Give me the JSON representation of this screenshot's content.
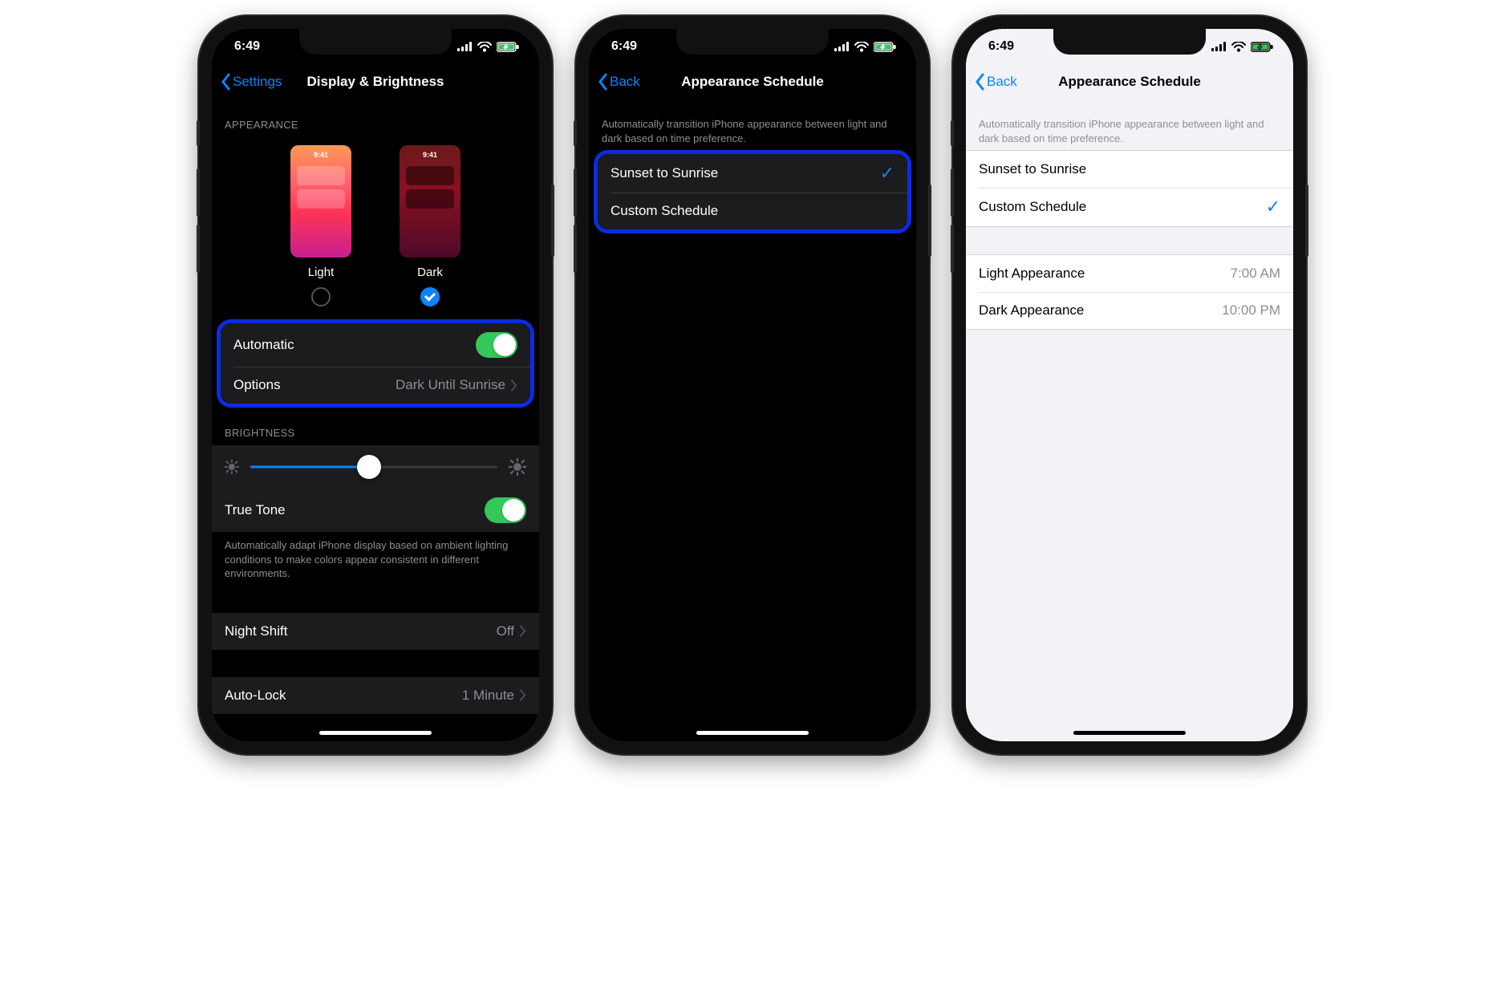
{
  "status": {
    "time": "6:49"
  },
  "screen1": {
    "back_label": "Settings",
    "title": "Display & Brightness",
    "appearance_header": "Appearance",
    "thumb_time": "9:41",
    "light_label": "Light",
    "dark_label": "Dark",
    "automatic_label": "Automatic",
    "options_label": "Options",
    "options_value": "Dark Until Sunrise",
    "brightness_header": "Brightness",
    "brightness_value_pct": 48,
    "truetone_label": "True Tone",
    "truetone_footer": "Automatically adapt iPhone display based on ambient lighting conditions to make colors appear consistent in different environments.",
    "nightshift_label": "Night Shift",
    "nightshift_value": "Off",
    "autolock_label": "Auto-Lock",
    "autolock_value": "1 Minute"
  },
  "screen2": {
    "back_label": "Back",
    "title": "Appearance Schedule",
    "intro": "Automatically transition iPhone appearance between light and dark based on time preference.",
    "opt_sunset": "Sunset to Sunrise",
    "opt_custom": "Custom Schedule",
    "selected": "sunset"
  },
  "screen3": {
    "back_label": "Back",
    "title": "Appearance Schedule",
    "intro": "Automatically transition iPhone appearance between light and dark based on time preference.",
    "opt_sunset": "Sunset to Sunrise",
    "opt_custom": "Custom Schedule",
    "selected": "custom",
    "light_label": "Light Appearance",
    "light_time": "7:00 AM",
    "dark_label": "Dark Appearance",
    "dark_time": "10:00 PM"
  }
}
